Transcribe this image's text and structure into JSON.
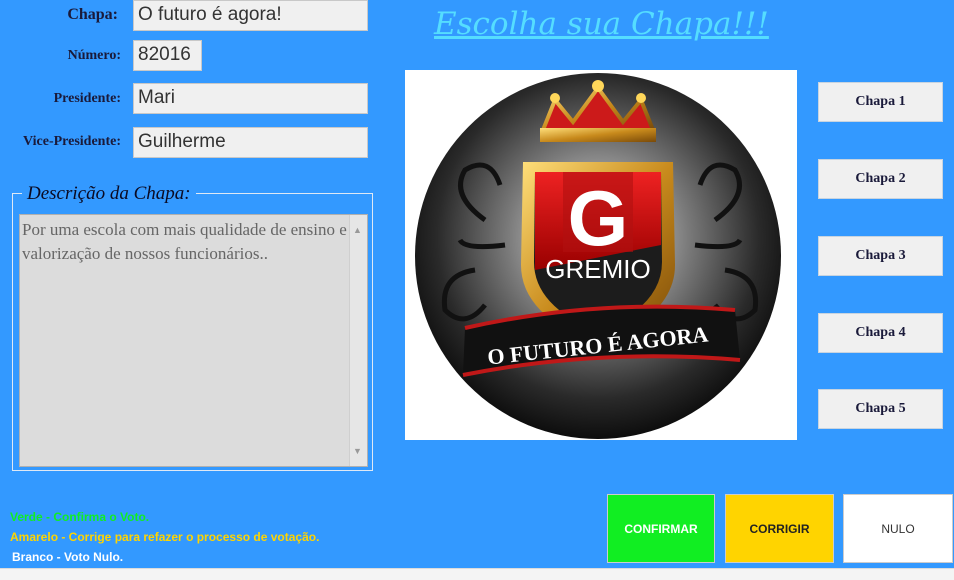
{
  "labels": {
    "chapa": "Chapa:",
    "numero": "Número:",
    "presidente": "Presidente:",
    "vice": "Vice-Presidente:"
  },
  "fields": {
    "chapa": "O futuro é agora!",
    "numero": "82016",
    "presidente": "Mari",
    "vice": "Guilherme"
  },
  "title": "Escolha sua Chapa!!!",
  "description": {
    "legend": "Descrição da Chapa:",
    "text": "Por uma escola com mais qualidade de ensino e valorização de nossos funcionários.."
  },
  "logo": {
    "letter": "G",
    "name": "GREMIO",
    "motto": "O FUTURO É AGORA"
  },
  "chapa_buttons": [
    "Chapa 1",
    "Chapa 2",
    "Chapa 3",
    "Chapa 4",
    "Chapa 5"
  ],
  "instructions": {
    "verde": "Verde - Confirma o Voto.",
    "amarelo": "Amarelo - Corrige para refazer o processo de votação.",
    "branco": "Branco - Voto Nulo."
  },
  "vote_buttons": {
    "confirmar": "CONFIRMAR",
    "corrigir": "CORRIGIR",
    "nulo": "NULO"
  },
  "colors": {
    "background": "#3399ff",
    "confirm": "#11ee22",
    "corrigir": "#ffd400",
    "nulo": "#ffffff"
  }
}
